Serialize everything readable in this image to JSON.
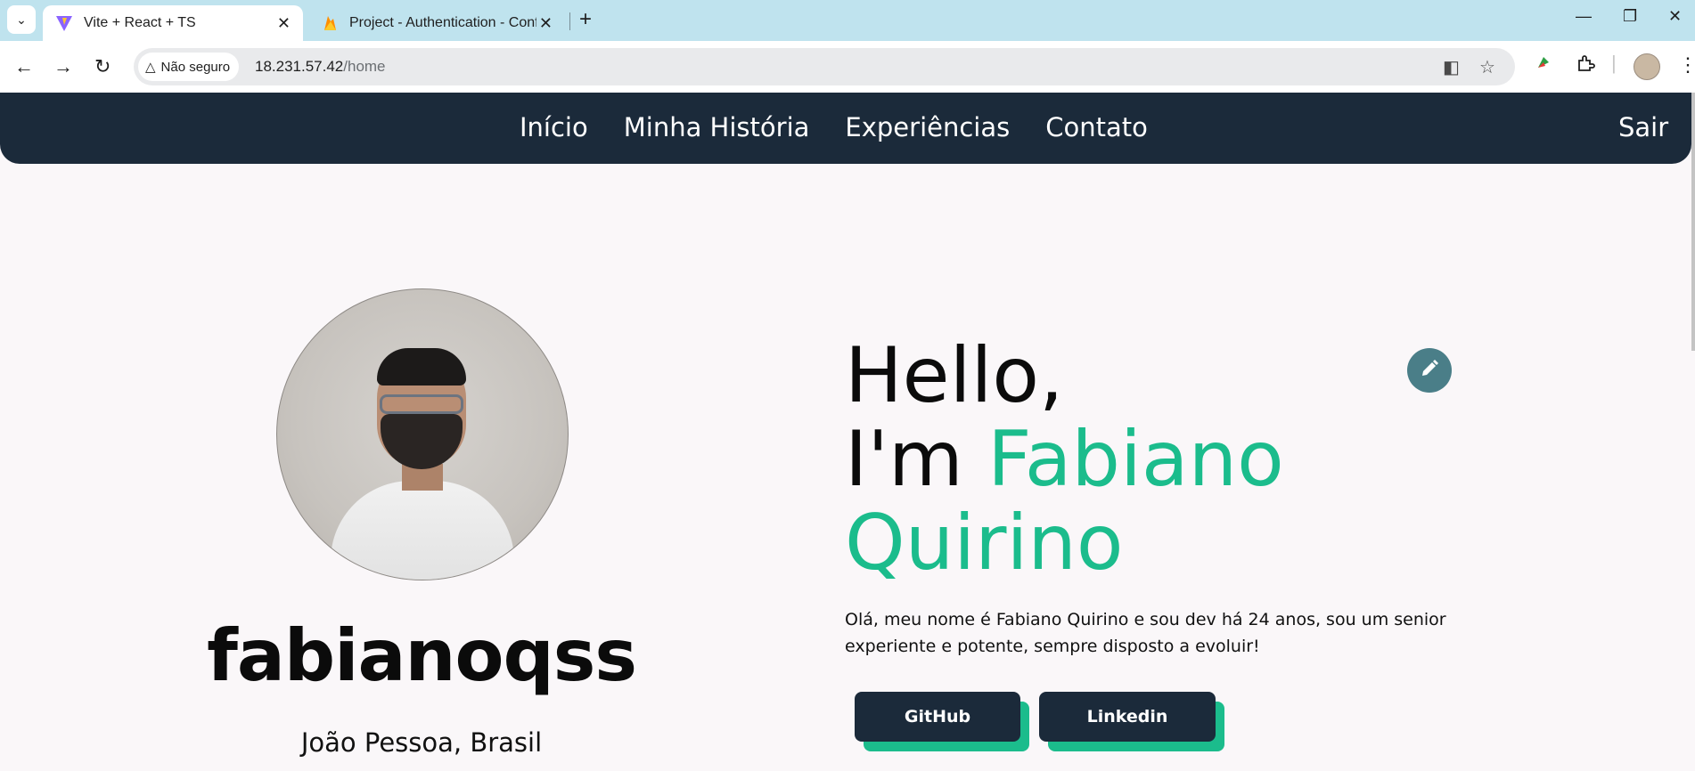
{
  "browser": {
    "tabs": [
      {
        "title": "Vite + React + TS",
        "active": true,
        "favicon": "vite-icon"
      },
      {
        "title": "Project - Authentication - Confi",
        "active": false,
        "favicon": "firebase-icon"
      }
    ],
    "security_label": "Não seguro",
    "url_host": "18.231.57.42",
    "url_path": "/home"
  },
  "nav": {
    "links": [
      "Início",
      "Minha História",
      "Experiências",
      "Contato"
    ],
    "logout": "Sair"
  },
  "profile": {
    "username": "fabianoqss",
    "location": "João Pessoa, Brasil"
  },
  "hero": {
    "line1": "Hello,",
    "line2_prefix": "I'm ",
    "name_first": "Fabiano",
    "name_last": "Quirino",
    "bio": "Olá, meu nome é Fabiano Quirino e sou dev há 24 anos, sou um senior experiente e potente, sempre disposto a evoluir!"
  },
  "buttons": {
    "github": "GitHub",
    "linkedin": "Linkedin"
  },
  "colors": {
    "nav_bg": "#1b2a3a",
    "accent": "#1bbc8c",
    "edit_button": "#4a7e88",
    "page_bg": "#faf7f9"
  }
}
